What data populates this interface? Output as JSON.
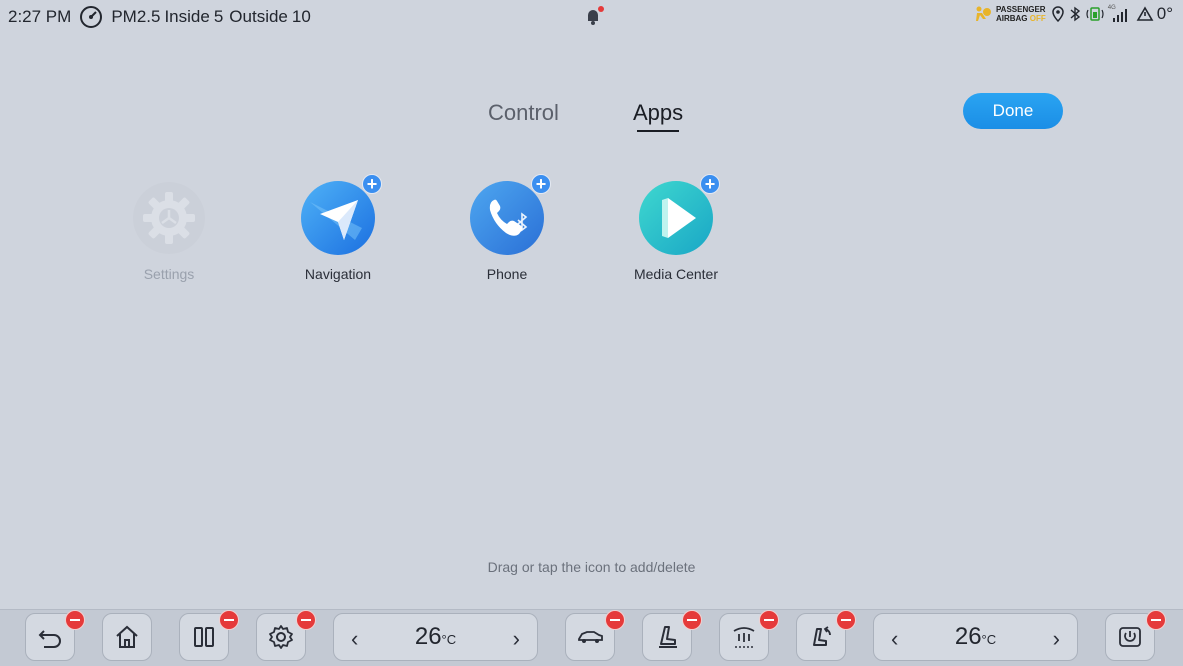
{
  "status": {
    "time": "2:27 PM",
    "pm25_label": "PM2.5",
    "inside_label": "Inside",
    "inside_value": "5",
    "outside_label": "Outside",
    "outside_value": "10",
    "airbag_line1": "PASSENGER",
    "airbag_line2": "AIRBAG",
    "airbag_line3": "OFF",
    "signal_label": "4G",
    "outside_temp": "0°"
  },
  "tabs": [
    {
      "label": "Control",
      "active": false
    },
    {
      "label": "Apps",
      "active": true
    }
  ],
  "done_label": "Done",
  "apps": [
    {
      "label": "Settings",
      "icon": "settings-icon",
      "state": "disabled"
    },
    {
      "label": "Navigation",
      "icon": "navigation-icon",
      "state": "addable"
    },
    {
      "label": "Phone",
      "icon": "phone-icon",
      "state": "addable"
    },
    {
      "label": "Media Center",
      "icon": "media-center-icon",
      "state": "addable"
    }
  ],
  "hint": "Drag or tap the icon to add/delete",
  "dock": {
    "left_temp": "26",
    "right_temp": "26",
    "temp_unit": "°C",
    "buttons": [
      "back-icon",
      "home-icon",
      "split-screen-icon",
      "settings-icon",
      "car-icon",
      "seat-heat-icon",
      "windshield-defrost-icon",
      "seat-ventilation-icon",
      "power-icon"
    ]
  },
  "colors": {
    "background": "#cfd4dd",
    "accent_blue": "#1b8ee6",
    "remove_red": "#e53a3a",
    "airbag_off_yellow": "#e8b42a"
  }
}
